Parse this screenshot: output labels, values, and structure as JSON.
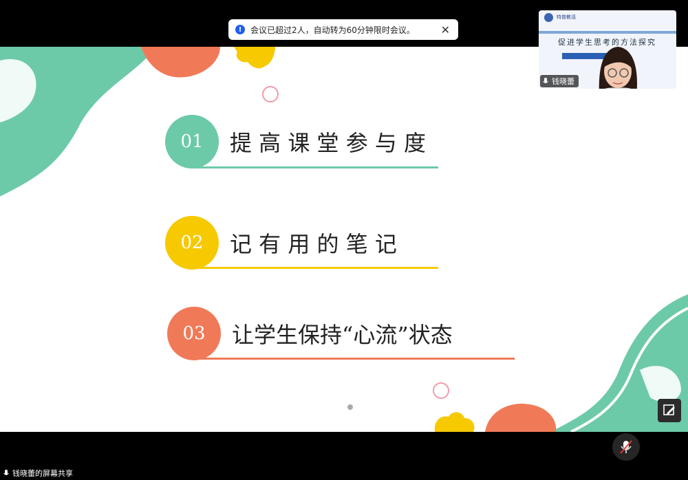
{
  "toast": {
    "message": "会议已超过2人，自动转为60分钟限时会议。",
    "close_symbol": "✕",
    "info_symbol": "!"
  },
  "video": {
    "participant_name": "钱晓蕾",
    "slide_title": "促进学生思考的方法探究",
    "logo_text": "特普教话"
  },
  "slide": {
    "items": [
      {
        "number": "01",
        "label": "提 高 课 堂 参 与 度",
        "color": "#6ccaa9"
      },
      {
        "number": "02",
        "label": "记 有 用 的 笔 记",
        "color": "#f6c900"
      },
      {
        "number": "03",
        "label": "让学生保持“心流”状态",
        "color": "#f07a58"
      }
    ]
  },
  "share": {
    "label": "钱晓蕾的屏幕共享"
  },
  "colors": {
    "teal": "#6ccaa9",
    "yellow": "#f6c900",
    "coral": "#f07a58",
    "pink": "#f19aa9"
  }
}
